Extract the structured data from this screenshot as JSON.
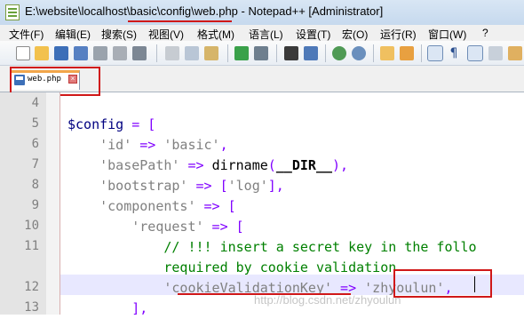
{
  "window": {
    "title": "E:\\website\\localhost\\basic\\config\\web.php - Notepad++ [Administrator]"
  },
  "menu": {
    "items": [
      "文件(F)",
      "编辑(E)",
      "搜索(S)",
      "视图(V)",
      "格式(M)",
      "语言(L)",
      "设置(T)",
      "宏(O)",
      "运行(R)",
      "窗口(W)",
      "?"
    ]
  },
  "toolbar": {
    "icons": [
      "new-file-icon",
      "open-file-icon",
      "save-icon",
      "save-all-icon",
      "close-icon",
      "close-all-icon",
      "print-icon",
      "cut-icon",
      "copy-icon",
      "paste-icon",
      "undo-icon",
      "redo-icon",
      "find-icon",
      "replace-icon",
      "zoom-in-icon",
      "zoom-out-icon",
      "sync-vertical-icon",
      "sync-horizontal-icon",
      "word-wrap-icon",
      "show-all-chars-icon",
      "indent-guide-icon",
      "udl-icon",
      "doc-map-icon"
    ]
  },
  "tabs": [
    {
      "label": "web.php",
      "active": true
    }
  ],
  "editor": {
    "line_numbers": [
      "4",
      "5",
      "6",
      "7",
      "8",
      "9",
      "10",
      "11",
      "",
      "12",
      "13"
    ],
    "lines": [
      {
        "tokens": []
      },
      {
        "tokens": [
          [
            "var",
            "$config"
          ],
          [
            "op",
            " = ["
          ]
        ]
      },
      {
        "tokens": [
          [
            "txt",
            "    "
          ],
          [
            "str",
            "'id'"
          ],
          [
            "op",
            " => "
          ],
          [
            "str",
            "'basic'"
          ],
          [
            "op",
            ","
          ]
        ]
      },
      {
        "tokens": [
          [
            "txt",
            "    "
          ],
          [
            "str",
            "'basePath'"
          ],
          [
            "op",
            " => "
          ],
          [
            "fn",
            "dirname"
          ],
          [
            "op",
            "("
          ],
          [
            "cst",
            "__DIR__"
          ],
          [
            "op",
            "),"
          ]
        ]
      },
      {
        "tokens": [
          [
            "txt",
            "    "
          ],
          [
            "str",
            "'bootstrap'"
          ],
          [
            "op",
            " => ["
          ],
          [
            "str",
            "'log'"
          ],
          [
            "op",
            "],"
          ]
        ]
      },
      {
        "tokens": [
          [
            "txt",
            "    "
          ],
          [
            "str",
            "'components'"
          ],
          [
            "op",
            " => ["
          ]
        ]
      },
      {
        "tokens": [
          [
            "txt",
            "        "
          ],
          [
            "str",
            "'request'"
          ],
          [
            "op",
            " => ["
          ]
        ]
      },
      {
        "tokens": [
          [
            "txt",
            "            "
          ],
          [
            "cmt",
            "// !!! insert a secret key in the follo"
          ]
        ]
      },
      {
        "tokens": [
          [
            "txt",
            "            "
          ],
          [
            "cmt",
            "required by cookie validation"
          ]
        ]
      },
      {
        "tokens": [
          [
            "txt",
            "            "
          ],
          [
            "str",
            "'cookieValidationKey'"
          ],
          [
            "op",
            " => "
          ],
          [
            "str",
            "'zhyoulun'"
          ],
          [
            "op",
            ","
          ]
        ]
      },
      {
        "tokens": [
          [
            "txt",
            "        "
          ],
          [
            "op",
            "],"
          ]
        ]
      }
    ],
    "watermark": "http://blog.csdn.net/zhyoulun"
  },
  "colors": {
    "annotation_red": "#d01818",
    "current_line": "#e8e8ff",
    "string": "#808080",
    "operator": "#8000ff",
    "variable": "#000080",
    "comment": "#008000"
  }
}
